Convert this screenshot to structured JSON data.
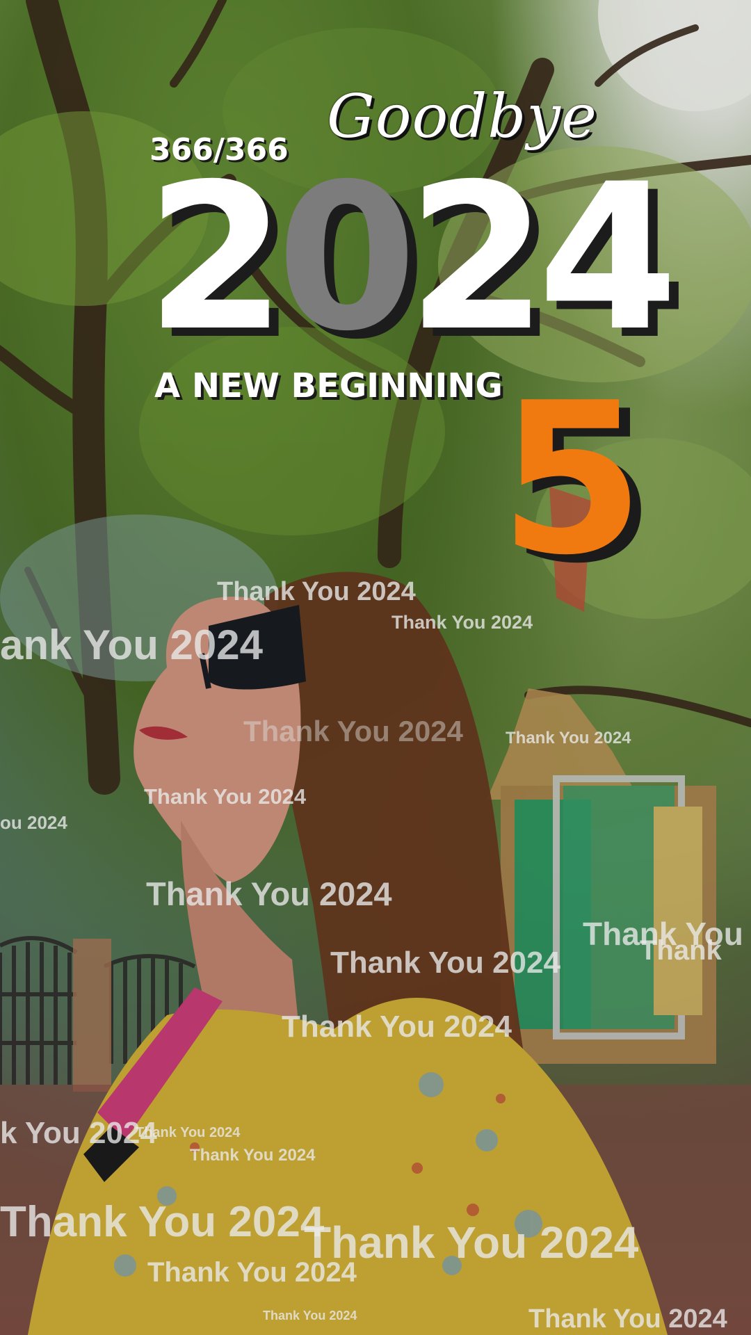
{
  "photo": {
    "description_icon": "photo-background",
    "accent_orange": "#f07a10",
    "grey_digit": "#7c7c7c"
  },
  "title": {
    "counter": "366/366",
    "goodbye": "Goodbye",
    "year_digits": [
      "2",
      "0",
      "2",
      "4"
    ],
    "tagline": "A NEW BEGINNING",
    "next_digit": "5"
  },
  "overlay_text": "Thank You 2024",
  "overlay_fragments": {
    "left_cut_1": "ank You 2024",
    "left_cut_2": "ou 2024",
    "left_cut_3": "k You 2024",
    "right_cut_1": "Thank You",
    "right_cut_2": "Thank"
  }
}
